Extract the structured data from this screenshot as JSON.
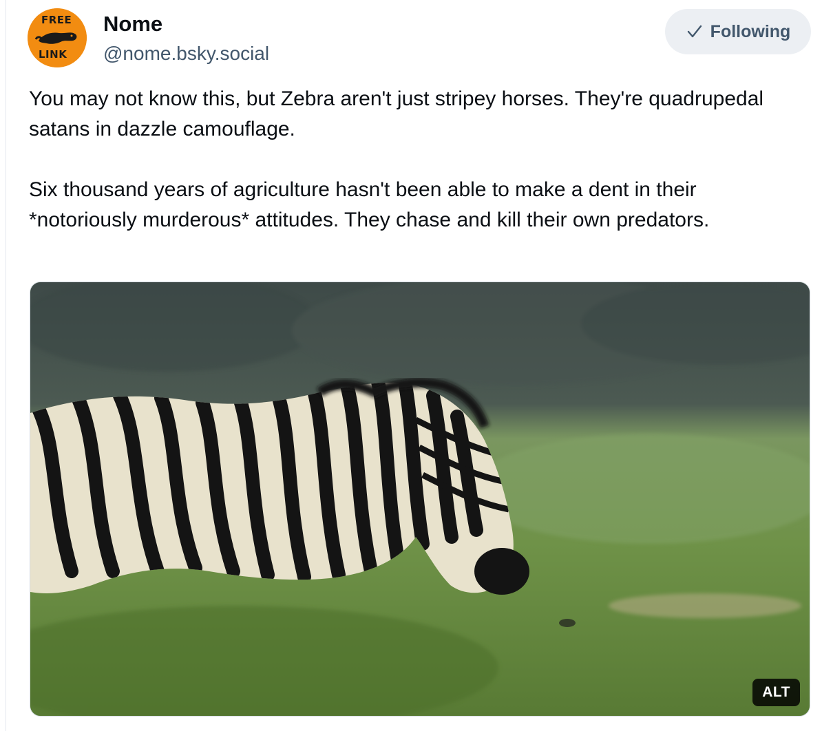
{
  "post": {
    "author": {
      "display_name": "Nome",
      "handle": "@nome.bsky.social",
      "avatar_text_top": "FREE",
      "avatar_text_bottom": "LINK",
      "avatar_color": "#f28c11"
    },
    "follow_button": {
      "label": "Following",
      "icon": "checkmark-icon"
    },
    "text_paragraphs": [
      "You may not know this, but Zebra aren't just stripey horses. They're quadrupedal satans in dazzle camouflage.",
      "Six thousand years of agriculture hasn't been able to make a dent in their *notoriously murderous* attitudes. They chase and kill their own predators."
    ],
    "media": {
      "type": "image",
      "subject": "zebra-photo",
      "alt_badge": "ALT"
    }
  },
  "colors": {
    "text_primary": "#0b0f14",
    "text_secondary": "#42576c",
    "button_bg": "#eceff3",
    "border": "#d4dbe2"
  }
}
